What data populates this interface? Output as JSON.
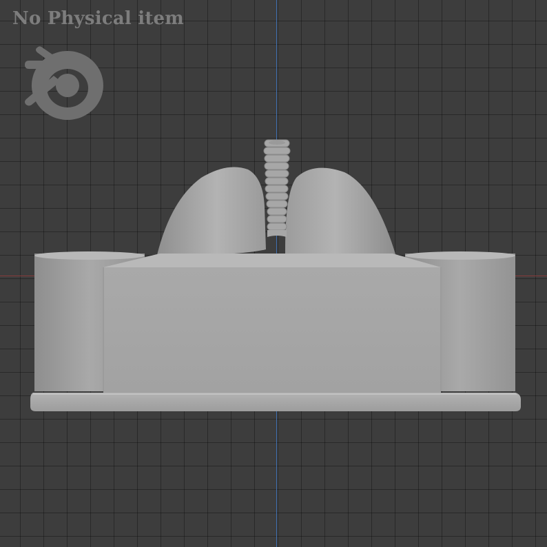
{
  "viewport": {
    "background_color": "#3d3d3d",
    "grid_color": "#2e2e2e",
    "axis_x_color": "#8a3a3a",
    "axis_y_color": "#3f6fb0"
  },
  "watermark": {
    "text": "No Physical item",
    "color": "#7d7d7d",
    "logo_icon": "blender-logo-icon"
  },
  "model": {
    "object": "lung-and-trachea-model-on-base",
    "material_color": "#a8a8a8"
  }
}
